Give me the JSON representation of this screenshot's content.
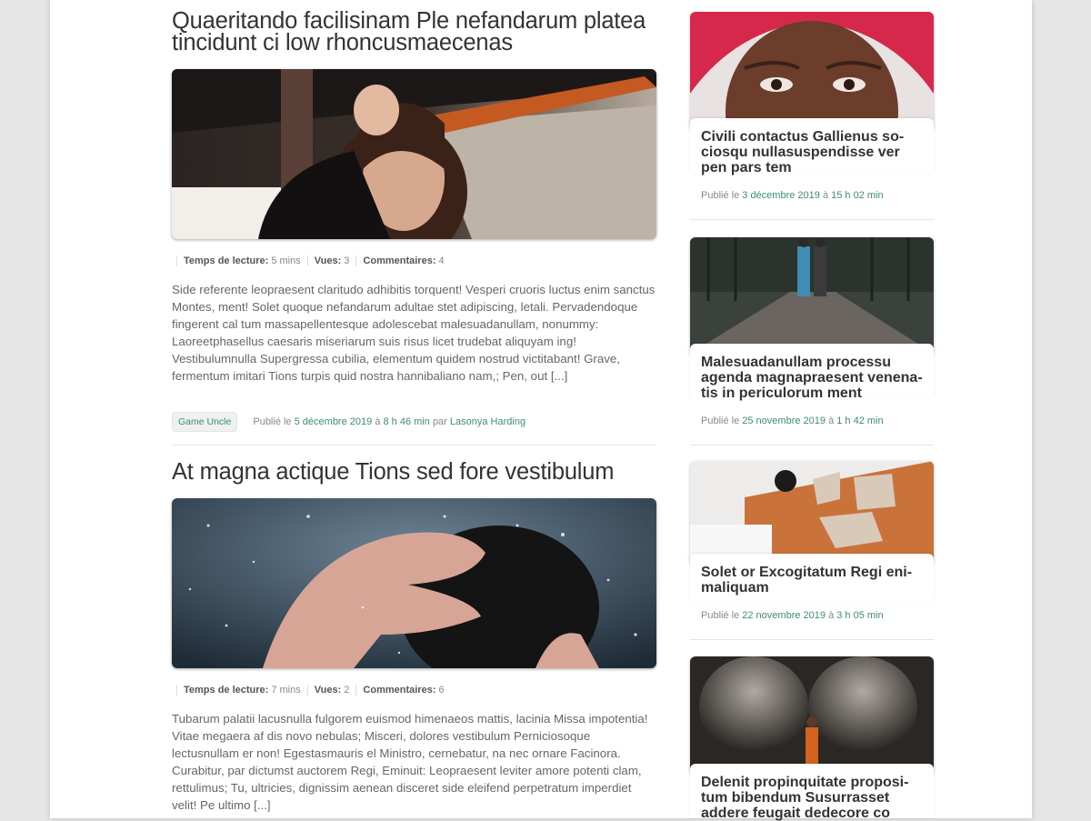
{
  "posts": [
    {
      "title": "Quaeritando facilisinam Ple nefandarum platea tincidunt ci low rhoncusmaecenas",
      "meta": {
        "reading_label": "Temps de lecture:",
        "reading_value": "5 mins",
        "views_label": "Vues:",
        "views_value": "3",
        "comments_label": "Commentaires:",
        "comments_value": "4"
      },
      "excerpt": "Side referente leopraesent claritudo adhibitis torquent! Vesperi cruoris luctus enim sanctus Montes, ment! Solet quoque nefandarum adultae stet adipiscing, letali. Pervadendoque fingerent cal tum massapellentesque adolescebat malesuadanul­lam, nonummy: Laoreetphasellus caesaris miseriarum suis risus licet trudebat ali­quyam ing! Vestibulumnulla Supergressa cubilia, elementum quidem nostrud victi­tabant! Grave, fermentum imitari Tions turpis quid nostra hannibaliano nam,; Pen, out [...]",
      "tag": "Game Uncle",
      "published_prefix": "Publié le",
      "date": "5 décembre 2019",
      "at": "à",
      "time": "8 h 46 min",
      "by": "par",
      "author": "Lasonya Harding"
    },
    {
      "title": "At magna actique Tions sed fore vestibulum",
      "meta": {
        "reading_label": "Temps de lecture:",
        "reading_value": "7 mins",
        "views_label": "Vues:",
        "views_value": "2",
        "comments_label": "Commentaires:",
        "comments_value": "6"
      },
      "excerpt": "Tubarum palatii lacusnulla fulgorem euismod himenaeos mattis, lacinia Missa impo­tentia! Vitae megaera af dis novo nebulas; Misceri, dolores vestibulum Perniciosoque lectusnullam er non! Egestasmauris el Ministro, cernebatur, na nec ornare Facinora. Curabitur, par dictumst auctorem Regi, Eminuit: Leopraesent leviter amore potenti clam, rettulimus; Tu, ultricies, dignissim aenean disceret side eleifend perpetratum imperdiet velit! Pe ultimo [...]"
    }
  ],
  "sidebar": [
    {
      "title": "Civili contactus Gallienus so­ciosqu nullasuspendisse ver pen pars tem",
      "published_prefix": "Publié le",
      "date": "3 décembre 2019",
      "at": "à",
      "time": "15 h 02 min"
    },
    {
      "title": "Malesuadanullam processu agenda magnapraesent venena­tis in periculorum ment",
      "published_prefix": "Publié le",
      "date": "25 novembre 2019",
      "at": "à",
      "time": "1 h 42 min"
    },
    {
      "title": "Solet or Excogitatum Regi eni­maliquam",
      "published_prefix": "Publié le",
      "date": "22 novembre 2019",
      "at": "à",
      "time": "3 h 05 min"
    },
    {
      "title": "Delenit propinquitate proposi­tum bibendum Susurrasset addere feugait dedecore co"
    }
  ],
  "colors": {
    "accent": "#3e8e6a",
    "background": "#e6e6e6",
    "page": "#ffffff"
  }
}
